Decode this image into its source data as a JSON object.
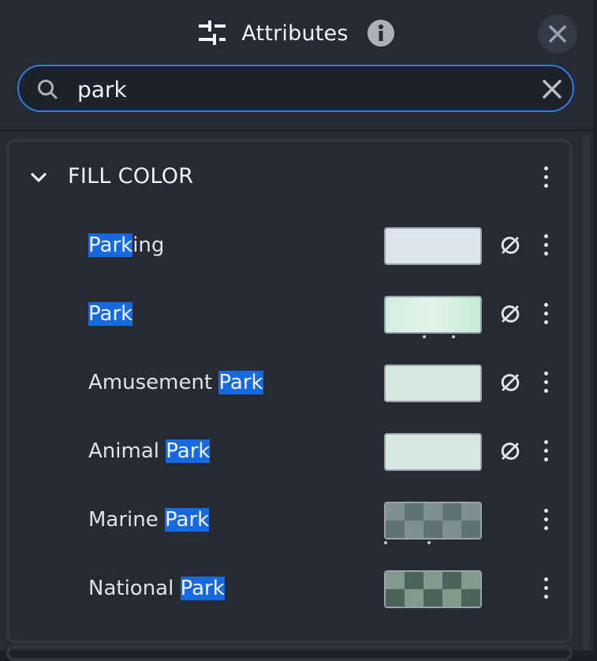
{
  "header": {
    "title": "Attributes",
    "title_icon": "sliders-icon",
    "info_icon": "info-icon",
    "close_icon": "close-icon"
  },
  "search": {
    "value": "park",
    "icon": "search-icon",
    "clear_icon": "clear-icon"
  },
  "section": {
    "title": "FILL COLOR",
    "expanded": true,
    "items": [
      {
        "pre": "",
        "match": "Park",
        "post": "ing",
        "swatch": {
          "type": "solid",
          "color": "#dde4ea"
        },
        "unlink": true,
        "dots": false
      },
      {
        "pre": "",
        "match": "Park",
        "post": "",
        "swatch": {
          "type": "gradient",
          "colors": [
            "#d2eedf",
            "#e3f4ea",
            "#c3ebd5"
          ]
        },
        "unlink": true,
        "dots": true
      },
      {
        "pre": "Amusement ",
        "match": "Park",
        "post": "",
        "swatch": {
          "type": "solid",
          "color": "#d6e6e2"
        },
        "unlink": true,
        "dots": false
      },
      {
        "pre": "Animal ",
        "match": "Park",
        "post": "",
        "swatch": {
          "type": "solid",
          "color": "#d7e7e3"
        },
        "unlink": true,
        "dots": false
      },
      {
        "pre": "Marine ",
        "match": "Park",
        "post": "",
        "swatch": {
          "type": "checker",
          "colors": [
            "#7e9093",
            "#5f7377"
          ]
        },
        "unlink": false,
        "dots": true
      },
      {
        "pre": "National ",
        "match": "Park",
        "post": "",
        "swatch": {
          "type": "checker",
          "colors": [
            "#829a8c",
            "#4a635a"
          ]
        },
        "unlink": false,
        "dots": false
      }
    ]
  },
  "colors": {
    "accent": "#2f7ce8",
    "highlight": "#1769e0",
    "panel": "#252a33"
  }
}
